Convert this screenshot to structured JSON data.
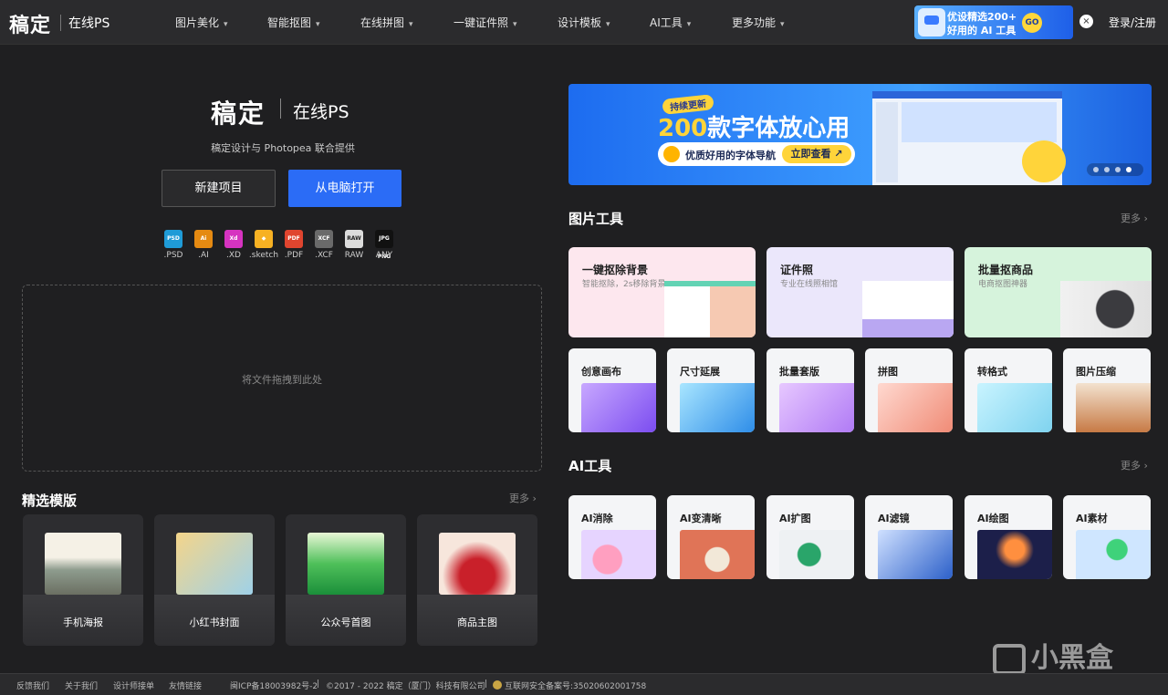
{
  "topbar": {
    "logo": "稿定",
    "logo_sub": "在线PS",
    "nav": [
      "图片美化",
      "智能抠图",
      "在线拼图",
      "一键证件照",
      "设计模板",
      "AI工具",
      "更多功能"
    ],
    "ad_line1": "优设精选200+",
    "ad_line2": "好用的 AI 工具",
    "ad_go": "GO",
    "close": "×",
    "login": "登录/注册"
  },
  "hero": {
    "brand": "稿定",
    "brand_sub": "在线PS",
    "desc": "稿定设计与 Photopea 联合提供",
    "new_project": "新建项目",
    "open_from_pc": "从电脑打开",
    "formats": [
      {
        "label": ".PSD",
        "badge": "PSD",
        "color": "#1f9bd7"
      },
      {
        "label": ".AI",
        "badge": "Ai",
        "color": "#e58a12"
      },
      {
        "label": ".XD",
        "badge": "Xd",
        "color": "#d633c0"
      },
      {
        "label": ".sketch",
        "badge": "◆",
        "color": "#f7b123"
      },
      {
        "label": ".PDF",
        "badge": "PDF",
        "color": "#e0452f"
      },
      {
        "label": ".XCF",
        "badge": "XCF",
        "color": "#6a6a6a"
      },
      {
        "label": "RAW",
        "badge": "RAW",
        "color": "#dcdcdc"
      },
      {
        "label": "ANY",
        "badge": "JPG PNG",
        "color": "#111111"
      }
    ]
  },
  "dropzone": {
    "text": "将文件拖拽到此处"
  },
  "templates": {
    "title": "精选模版",
    "more": "更多 ›",
    "items": [
      "手机海报",
      "小红书封面",
      "公众号首图",
      "商品主图"
    ]
  },
  "promo": {
    "tag": "持续更新",
    "num": "200",
    "headline": "款字体放心用",
    "pill_text": "优质好用的字体导航",
    "cta": "立即查看 ↗"
  },
  "image_tools": {
    "title": "图片工具",
    "more": "更多 ›",
    "big": [
      {
        "title": "一键抠除背景",
        "sub": "智能抠除，2s移除背景"
      },
      {
        "title": "证件照",
        "sub": "专业在线照相馆"
      },
      {
        "title": "批量抠商品",
        "sub": "电商抠图神器"
      }
    ],
    "small": [
      "创意画布",
      "尺寸延展",
      "批量套版",
      "拼图",
      "转格式",
      "图片压缩"
    ]
  },
  "ai_tools": {
    "title": "AI工具",
    "more": "更多 ›",
    "items": [
      "AI消除",
      "AI变清晰",
      "AI扩图",
      "AI滤镜",
      "AI绘图",
      "AI素材"
    ]
  },
  "footer": {
    "links": [
      "反馈我们",
      "关于我们",
      "设计师接单",
      "友情链接"
    ],
    "icp": "闽ICP备18003982号-2",
    "copyright": "©2017 - 2022 稿定（厦门）科技有限公司",
    "police": "互联网安全备案号:35020602001758"
  },
  "watermark": "小黑盒"
}
